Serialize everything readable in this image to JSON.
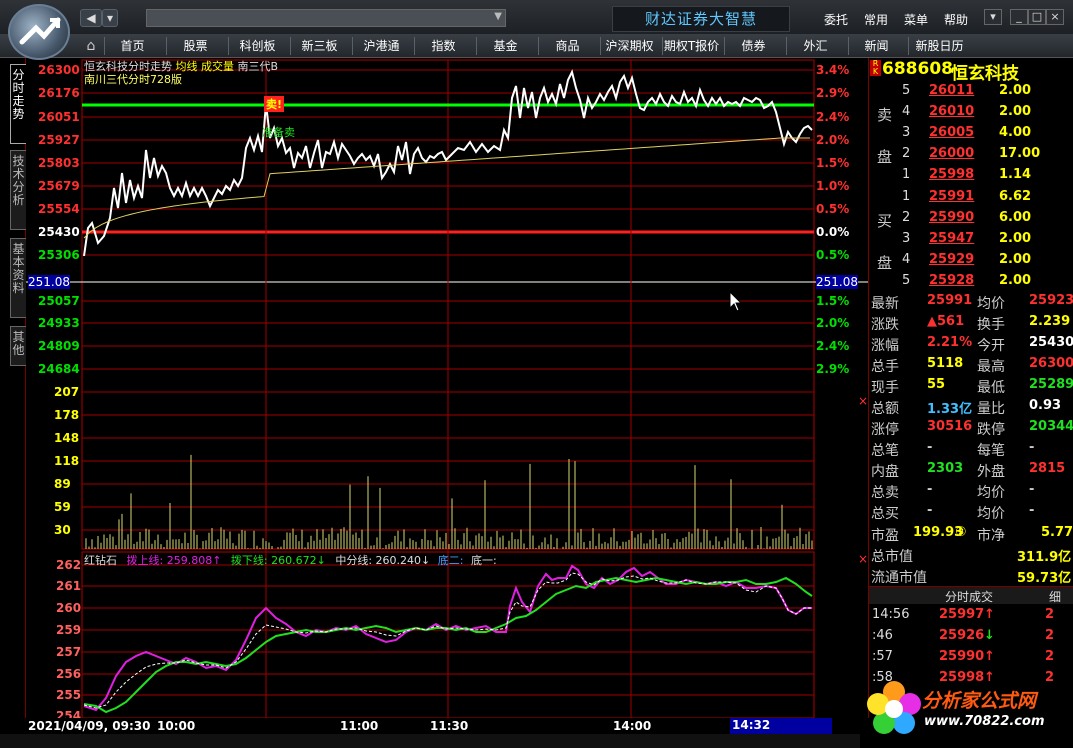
{
  "app": {
    "title": "财达证券大智慧",
    "menu": [
      "委托",
      "常用",
      "菜单",
      "帮助"
    ]
  },
  "nav": [
    "首页",
    "股票",
    "科创板",
    "新三板",
    "沪港通",
    "指数",
    "基金",
    "商品",
    "沪深期权",
    "期权T报价",
    "债券",
    "外汇",
    "新闻",
    "新股日历"
  ],
  "left_tabs": [
    "分时走势",
    "技术分析",
    "基本资料",
    "其他"
  ],
  "chart": {
    "title_parts": [
      "恒玄科技分时走势",
      "均线",
      "成交量",
      "南三代B"
    ],
    "subtitle": "南川三代分时728版",
    "sell_marker": "卖!",
    "annotation": "准备卖",
    "price_ticks": [
      "26300",
      "26176",
      "26051",
      "25927",
      "25803",
      "25679",
      "25554",
      "25430",
      "25306"
    ],
    "pct_ticks_up": [
      "3.4%",
      "2.9%",
      "2.4%",
      "2.0%",
      "1.5%",
      "1.0%",
      "0.5%",
      "0.0%",
      "0.5%"
    ],
    "highlight_left": "251.08",
    "highlight_right": "251.08",
    "lower_price_ticks": [
      "25057",
      "24933",
      "24809",
      "24684"
    ],
    "lower_pct_ticks": [
      "1.5%",
      "2.0%",
      "2.4%",
      "2.9%"
    ],
    "vol_ticks": [
      "207",
      "178",
      "148",
      "118",
      "89",
      "59",
      "30"
    ],
    "indicator_title": "红钻石",
    "indicator_items": [
      "拨上线: 259.808↑",
      "拨下线: 260.672↓",
      "中分线: 260.240↓",
      "底二:",
      "底一:"
    ],
    "indicator_ticks": [
      "262",
      "261",
      "260",
      "259",
      "257",
      "256",
      "255",
      "254"
    ],
    "time_axis": [
      "2021/04/09, 09:30",
      "10:00",
      "11:00",
      "11:30",
      "14:00"
    ],
    "cursor_time": "14:32"
  },
  "quote": {
    "code": "688608",
    "name": "恒玄科技",
    "rk": "R K",
    "sell_label": [
      "卖",
      "盘"
    ],
    "buy_label": [
      "买",
      "盘"
    ],
    "sell": [
      {
        "lvl": "5",
        "price": "26011",
        "vol": "2.00"
      },
      {
        "lvl": "4",
        "price": "26010",
        "vol": "2.00"
      },
      {
        "lvl": "3",
        "price": "26005",
        "vol": "4.00"
      },
      {
        "lvl": "2",
        "price": "26000",
        "vol": "17.00"
      },
      {
        "lvl": "1",
        "price": "25998",
        "vol": "1.14"
      }
    ],
    "buy": [
      {
        "lvl": "1",
        "price": "25991",
        "vol": "6.62"
      },
      {
        "lvl": "2",
        "price": "25990",
        "vol": "6.00"
      },
      {
        "lvl": "3",
        "price": "25947",
        "vol": "2.00"
      },
      {
        "lvl": "4",
        "price": "25929",
        "vol": "2.00"
      },
      {
        "lvl": "5",
        "price": "25928",
        "vol": "2.00"
      }
    ],
    "stats": [
      [
        "最新",
        "25991",
        "均价",
        "25923"
      ],
      [
        "涨跌",
        "▲561",
        "换手",
        "2.239"
      ],
      [
        "涨幅",
        "2.21%",
        "今开",
        "25430"
      ],
      [
        "总手",
        "5118",
        "最高",
        "26300"
      ],
      [
        "现手",
        "55",
        "最低",
        "25289"
      ],
      [
        "总额",
        "1.33亿",
        "量比",
        "0.93"
      ],
      [
        "涨停",
        "30516",
        "跌停",
        "20344"
      ],
      [
        "总笔",
        "-",
        "每笔",
        "-"
      ],
      [
        "内盘",
        "2303",
        "外盘",
        "2815"
      ],
      [
        "总卖",
        "-",
        "均价",
        "-"
      ],
      [
        "总买",
        "-",
        "均价",
        "-"
      ]
    ],
    "pe_label": "市盈",
    "pe": "199.93",
    "pe_circle": "③",
    "pb_label": "市净",
    "pb": "5.77",
    "mcap_label": "总市值",
    "mcap": "311.9亿",
    "float_label": "流通市值",
    "float": "59.73亿",
    "ticks_header": "分时成交",
    "ticks_tab": "细",
    "ticks": [
      {
        "t": "14:56",
        "p": "25997",
        "a": "↑",
        "v": "2"
      },
      {
        "t": ":46",
        "p": "25926",
        "a": "↓",
        "v": "2"
      },
      {
        "t": ":57",
        "p": "25990",
        "a": "↑",
        "v": "2"
      },
      {
        "t": ":58",
        "p": "25998",
        "a": "↑",
        "v": "2"
      }
    ]
  },
  "watermark": {
    "text": "分析家公式网",
    "url": "www.70822.com"
  },
  "colors": {
    "up": "#ff3030",
    "down": "#00e000",
    "yellow": "#ffff00",
    "grid": "#a00000",
    "price_line": "#ffffff",
    "avg_line": "#e0d060",
    "magenta": "#e020e0",
    "green": "#20e020"
  }
}
